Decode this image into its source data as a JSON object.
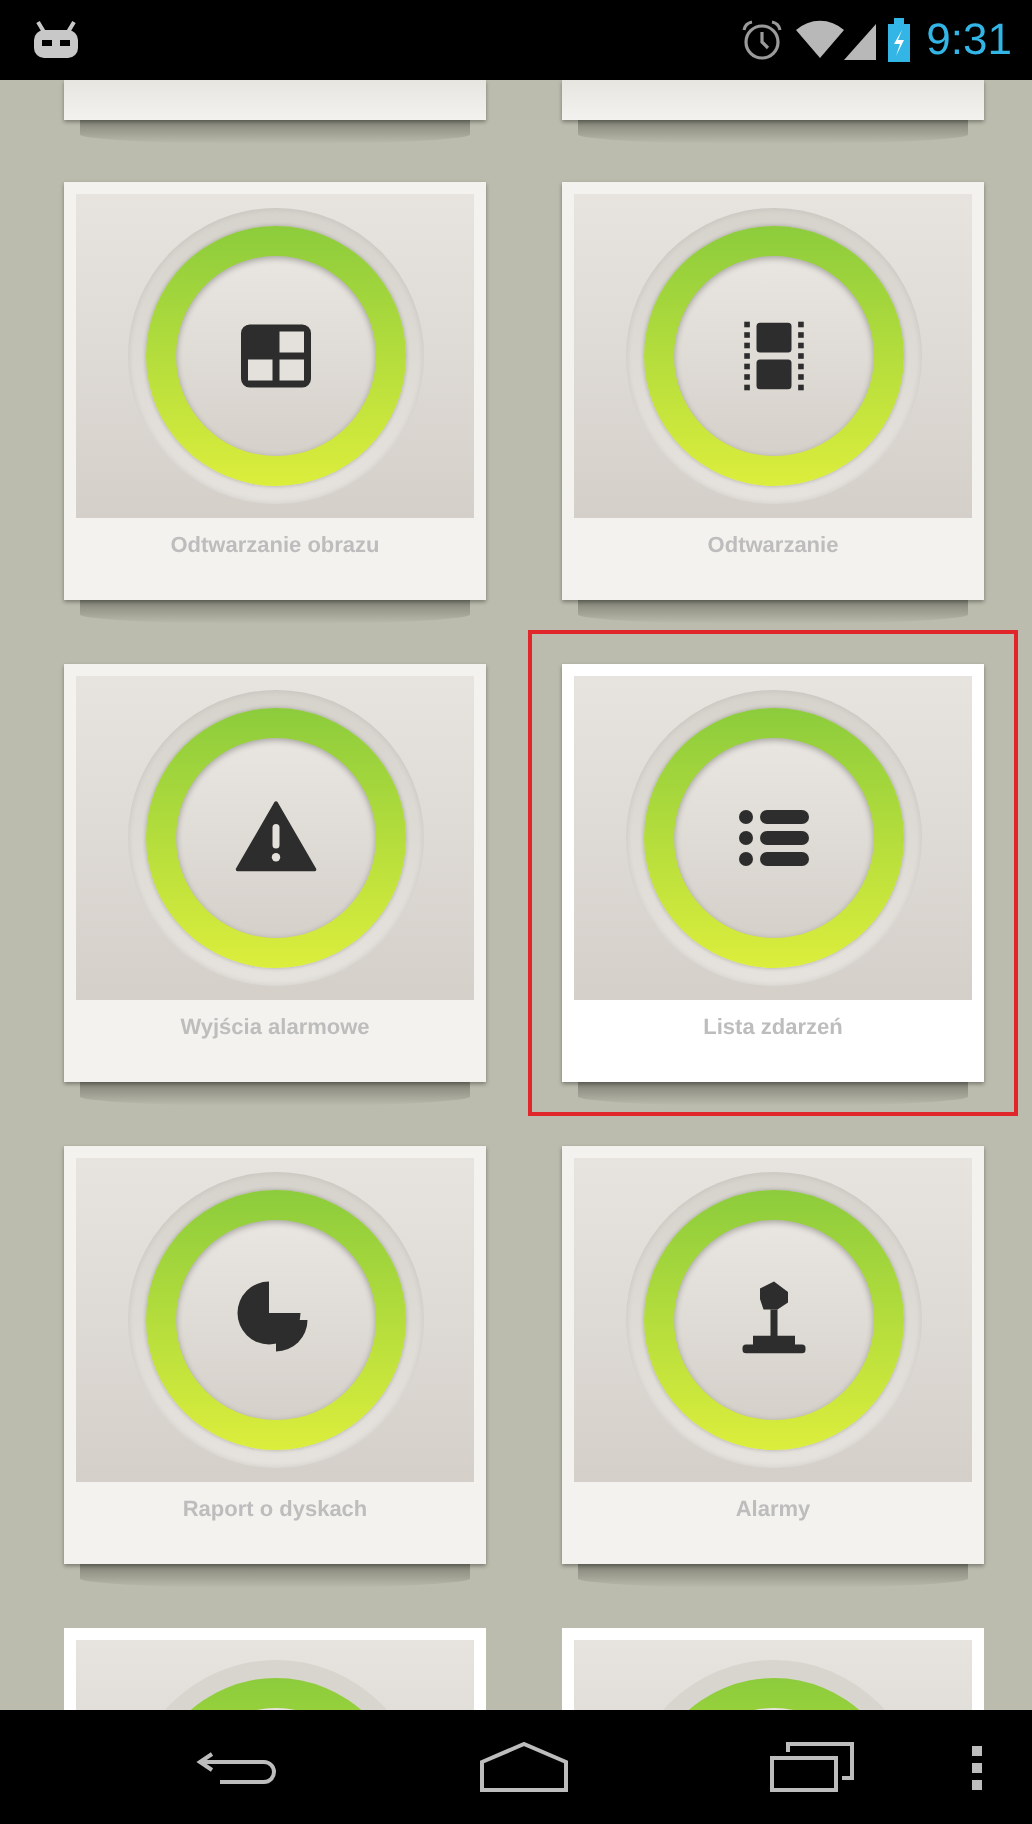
{
  "status_bar": {
    "time": "9:31"
  },
  "tiles": [
    {
      "label": "Odtwarzanie obrazu",
      "kind": "grid",
      "selected": false
    },
    {
      "label": "Odtwarzanie",
      "kind": "film",
      "selected": false
    },
    {
      "label": "Wyjścia alarmowe",
      "kind": "warning",
      "selected": false
    },
    {
      "label": "Lista zdarzeń",
      "kind": "list",
      "selected": true
    },
    {
      "label": "Raport o dyskach",
      "kind": "pie",
      "selected": false
    },
    {
      "label": "Alarmy",
      "kind": "press",
      "selected": false
    }
  ]
}
